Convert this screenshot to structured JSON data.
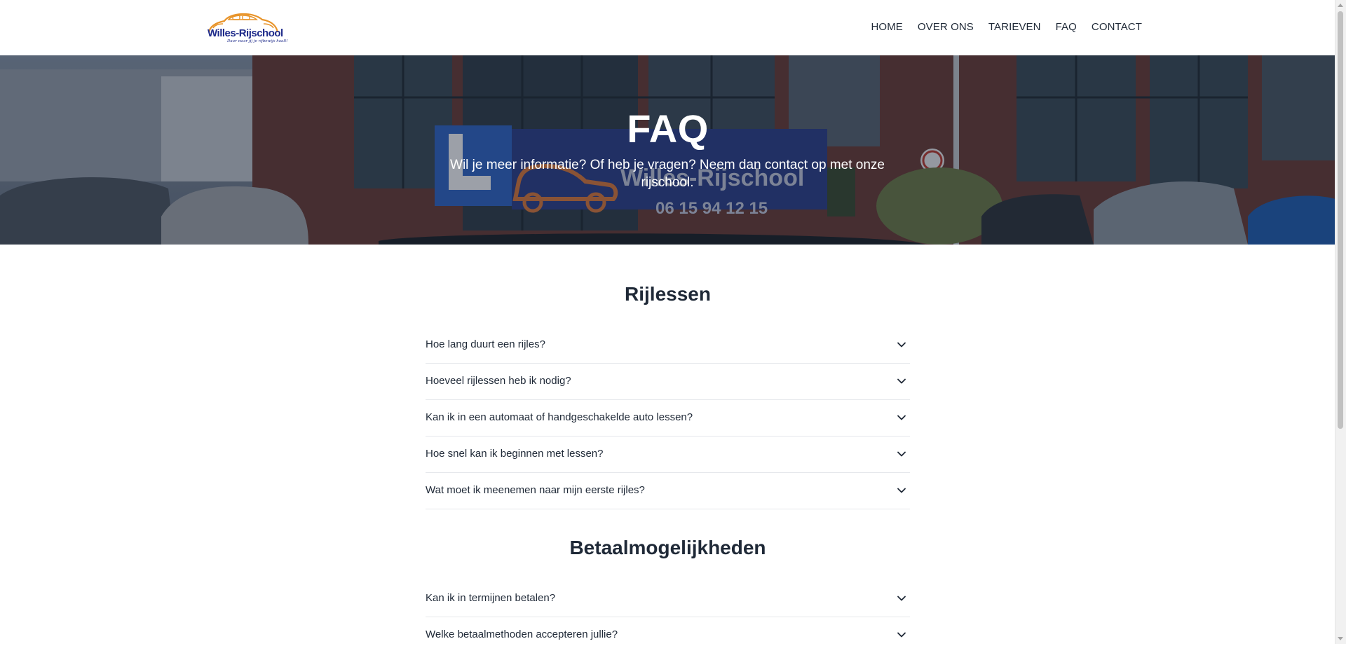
{
  "header": {
    "logo": {
      "name": "Willes-Rijschool",
      "tagline": "Daar waar jij je rijbewijs haalt!"
    },
    "nav": [
      "HOME",
      "OVER ONS",
      "TARIEVEN",
      "FAQ",
      "CONTACT"
    ]
  },
  "hero": {
    "title": "FAQ",
    "subtitle": "Wil je meer informatie? Of heb je vragen? Neem dan contact op met onze rijschool.",
    "sign_text": "Willes-Rijschool",
    "sign_phone": "06 15 94 12 15"
  },
  "sections": [
    {
      "title": "Rijlessen",
      "questions": [
        "Hoe lang duurt een rijles?",
        "Hoeveel rijlessen heb ik nodig?",
        "Kan ik in een automaat of handgeschakelde auto lessen?",
        "Hoe snel kan ik beginnen met lessen?",
        "Wat moet ik meenemen naar mijn eerste rijles?"
      ]
    },
    {
      "title": "Betaalmogelijkheden",
      "questions": [
        "Kan ik in termijnen betalen?",
        "Welke betaalmethoden accepteren jullie?"
      ]
    }
  ],
  "colors": {
    "logo_orange": "#e8942a",
    "logo_blue": "#1e2a8a",
    "text": "#1f2937",
    "divider": "#e5e7eb"
  }
}
